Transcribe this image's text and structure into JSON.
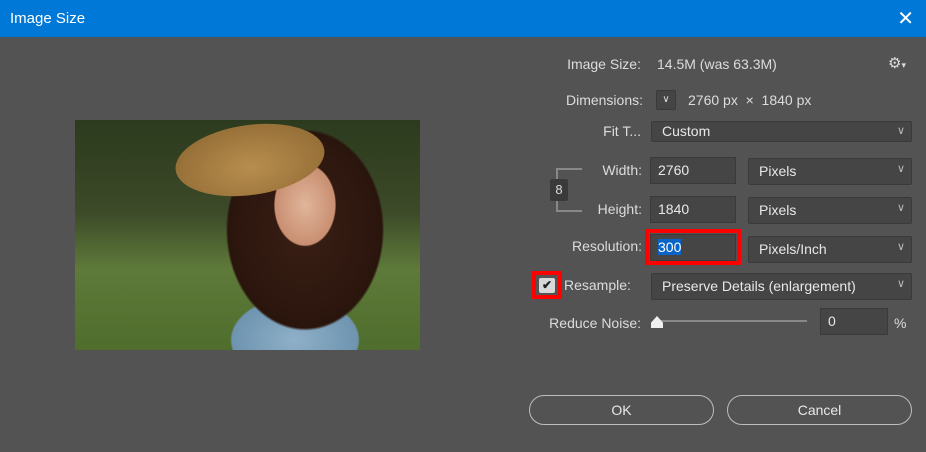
{
  "window": {
    "title": "Image Size",
    "close": "✕"
  },
  "image_size": {
    "label": "Image Size:",
    "value": "14.5M (was 63.3M)"
  },
  "dimensions": {
    "label": "Dimensions:",
    "value": "2760 px  ×  1840 px"
  },
  "fit_to": {
    "label": "Fit T...",
    "value": "Custom"
  },
  "width": {
    "label": "Width:",
    "value": "2760",
    "unit": "Pixels"
  },
  "height": {
    "label": "Height:",
    "value": "1840",
    "unit": "Pixels"
  },
  "resolution": {
    "label": "Resolution:",
    "value": "300",
    "unit": "Pixels/Inch"
  },
  "resample": {
    "label": "Resample:",
    "checked": true,
    "value": "Preserve Details (enlargement)"
  },
  "reduce_noise": {
    "label": "Reduce Noise:",
    "value": "0",
    "unit": "%",
    "slider_fraction": 0
  },
  "buttons": {
    "ok": "OK",
    "cancel": "Cancel"
  },
  "colors": {
    "titlebar": "#0078d7",
    "highlight": "#ff0000",
    "selection": "#0a64c8"
  }
}
